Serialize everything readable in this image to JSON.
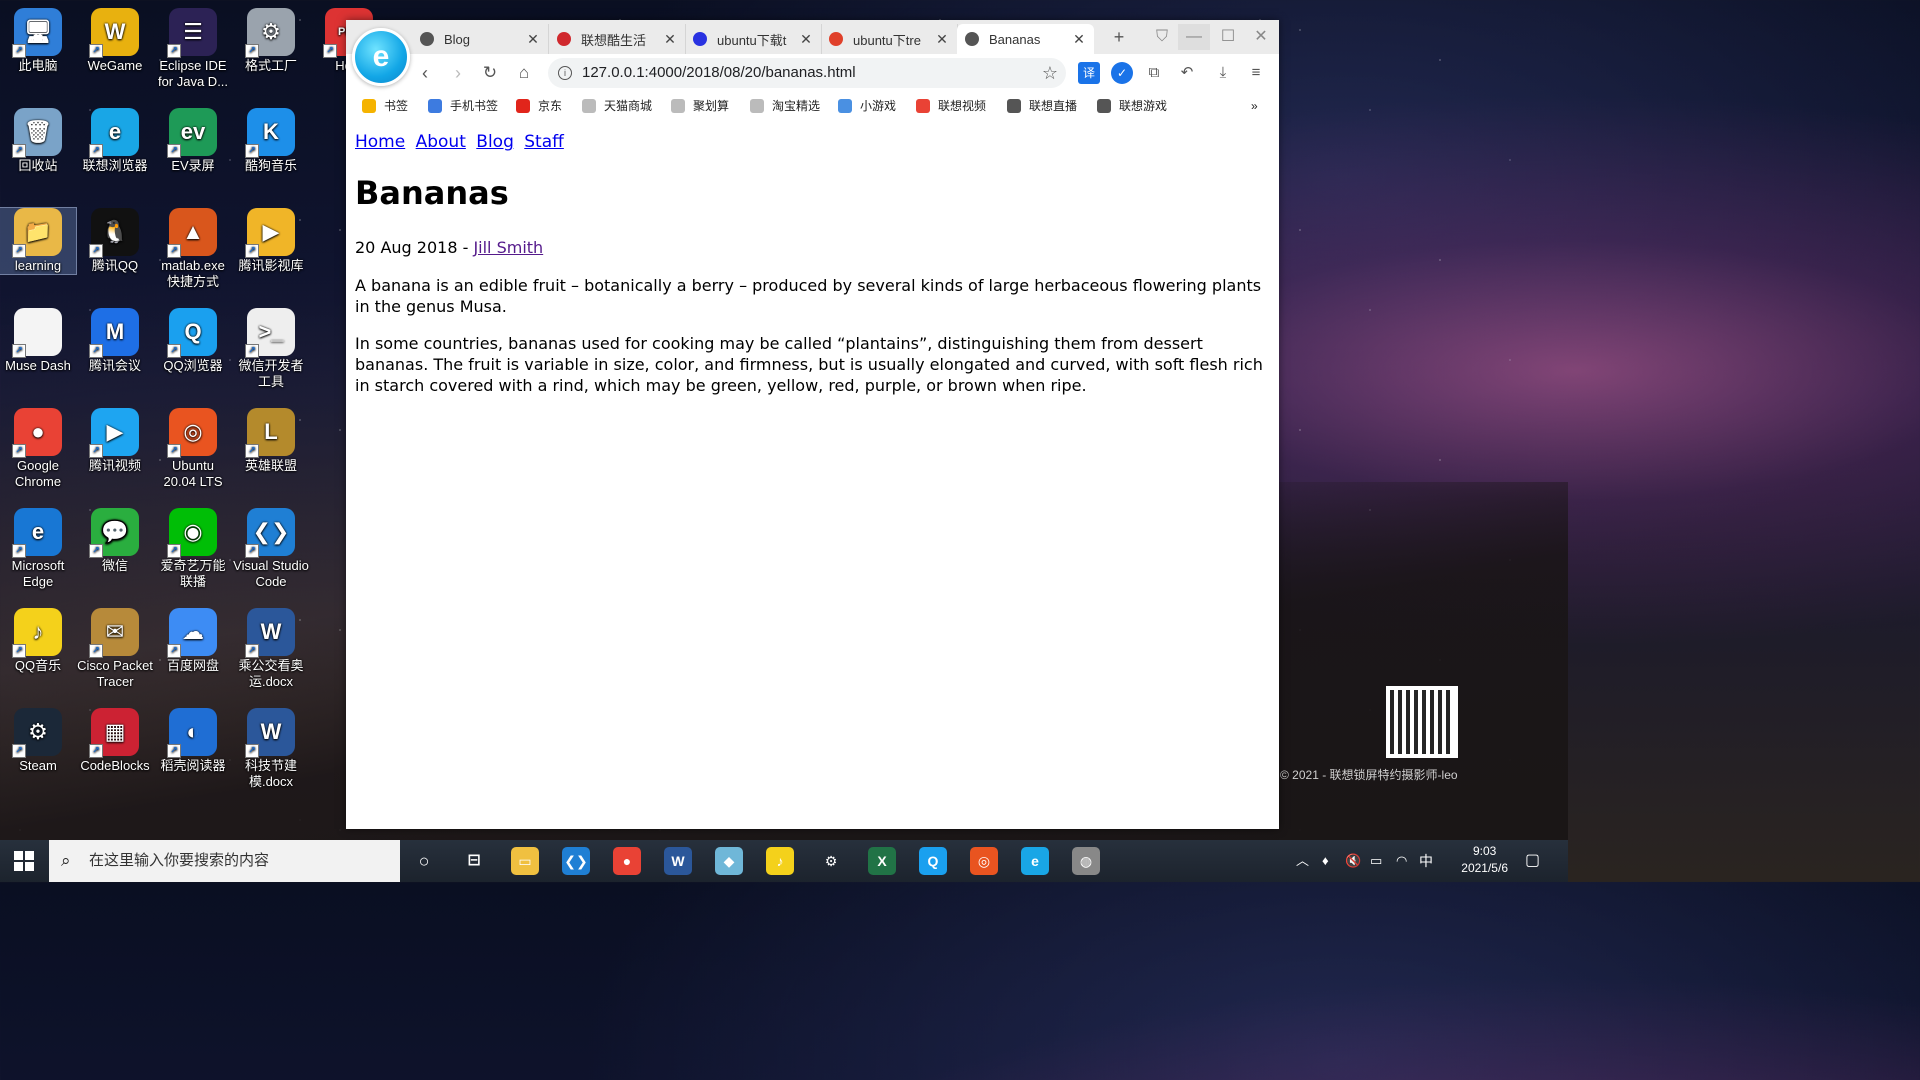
{
  "desktop": {
    "icons": [
      {
        "label": "此电脑",
        "color": "#2f7ed8",
        "glyph": "🖥"
      },
      {
        "label": "WeGame",
        "color": "#e8b10f",
        "glyph": "W"
      },
      {
        "label": "Eclipse IDE for Java D...",
        "color": "#2c2255",
        "glyph": "☰"
      },
      {
        "label": "格式工厂",
        "color": "#9aa3ad",
        "glyph": "⚙"
      },
      {
        "label": "Hom",
        "color": "#d33",
        "glyph": "PDF"
      },
      {
        "label": "回收站",
        "color": "#7aa3c8",
        "glyph": "🗑"
      },
      {
        "label": "联想浏览器",
        "color": "#19a6e6",
        "glyph": "e"
      },
      {
        "label": "EV录屏",
        "color": "#1e9a57",
        "glyph": "ev"
      },
      {
        "label": "酷狗音乐",
        "color": "#1d8fe9",
        "glyph": "K"
      },
      {
        "label": "learning",
        "color": "#e9b847",
        "glyph": "📁"
      },
      {
        "label": "腾讯QQ",
        "color": "#111",
        "glyph": "🐧"
      },
      {
        "label": "matlab.exe 快捷方式",
        "color": "#d9561c",
        "glyph": "▲"
      },
      {
        "label": "腾讯影视库",
        "color": "#f0b528",
        "glyph": "▶"
      },
      {
        "label": "Muse Dash",
        "color": "#f4f4f4",
        "glyph": ""
      },
      {
        "label": "腾讯会议",
        "color": "#1e6fe6",
        "glyph": "M"
      },
      {
        "label": "QQ浏览器",
        "color": "#1aa0ef",
        "glyph": "Q"
      },
      {
        "label": "微信开发者工具",
        "color": "#eee",
        "glyph": ">_"
      },
      {
        "label": "Google Chrome",
        "color": "#e94235",
        "glyph": "●"
      },
      {
        "label": "腾讯视频",
        "color": "#1ea5f1",
        "glyph": "▶"
      },
      {
        "label": "Ubuntu 20.04 LTS",
        "color": "#e95420",
        "glyph": "◎"
      },
      {
        "label": "英雄联盟",
        "color": "#b48a2c",
        "glyph": "L"
      },
      {
        "label": "Microsoft Edge",
        "color": "#1877d4",
        "glyph": "e"
      },
      {
        "label": "微信",
        "color": "#2aae3f",
        "glyph": "💬"
      },
      {
        "label": "爱奇艺万能联播",
        "color": "#00be06",
        "glyph": "◉"
      },
      {
        "label": "Visual Studio Code",
        "color": "#1f7fd4",
        "glyph": "❮❯"
      },
      {
        "label": "QQ音乐",
        "color": "#f4d11b",
        "glyph": "♪"
      },
      {
        "label": "Cisco Packet Tracer",
        "color": "#b78a3a",
        "glyph": "✉"
      },
      {
        "label": "百度网盘",
        "color": "#3d8cf4",
        "glyph": "☁"
      },
      {
        "label": "乘公交看奥运.docx",
        "color": "#2b579a",
        "glyph": "W"
      },
      {
        "label": "Steam",
        "color": "#1b2838",
        "glyph": "⚙"
      },
      {
        "label": "CodeBlocks",
        "color": "#c23",
        "glyph": "▦"
      },
      {
        "label": "稻壳阅读器",
        "color": "#1f6ed4",
        "glyph": "◐"
      },
      {
        "label": "科技节建模.docx",
        "color": "#2b579a",
        "glyph": "W"
      }
    ]
  },
  "browser": {
    "tabs": [
      {
        "title": "Blog",
        "favicon_color": "#555"
      },
      {
        "title": "联想酷生活",
        "favicon_color": "#d0282d"
      },
      {
        "title": "ubuntu下载t",
        "favicon_color": "#2932e1"
      },
      {
        "title": "ubuntu下tre",
        "favicon_color": "#e0402a"
      },
      {
        "title": "Bananas",
        "favicon_color": "#555"
      }
    ],
    "new_tab": "+",
    "url": "127.0.0.1:4000/2018/08/20/bananas.html",
    "bookmarks": [
      {
        "label": "书签",
        "color": "#f5b300"
      },
      {
        "label": "手机书签",
        "color": "#3d7be0"
      },
      {
        "label": "京东",
        "color": "#e1251b"
      },
      {
        "label": "天猫商城",
        "color": "#bbb"
      },
      {
        "label": "聚划算",
        "color": "#bbb"
      },
      {
        "label": "淘宝精选",
        "color": "#bbb"
      },
      {
        "label": "小游戏",
        "color": "#4a90e2"
      },
      {
        "label": "联想视频",
        "color": "#e94235"
      },
      {
        "label": "联想直播",
        "color": "#555"
      },
      {
        "label": "联想游戏",
        "color": "#555"
      }
    ],
    "bookmarks_more": "»",
    "page": {
      "nav": [
        "Home",
        "About",
        "Blog",
        "Staff"
      ],
      "title": "Bananas",
      "date": "20 Aug 2018 - ",
      "author": "Jill Smith",
      "paragraphs": [
        "A banana is an edible fruit – botanically a berry – produced by several kinds of large herbaceous flowering plants in the genus Musa.",
        "In some countries, bananas used for cooking may be called “plantains”, distinguishing them from dessert bananas. The fruit is variable in size, color, and firmness, but is usually elongated and curved, with soft flesh rich in starch covered with a rind, which may be green, yellow, red, purple, or brown when ripe."
      ]
    }
  },
  "taskbar": {
    "search_placeholder": "在这里输入你要搜索的内容",
    "time": "9:03",
    "date": "2021/5/6",
    "ime": "中",
    "apps": [
      {
        "name": "file-explorer",
        "color": "#f0c040",
        "glyph": "▭"
      },
      {
        "name": "vscode",
        "color": "#1f7fd4",
        "glyph": "❮❯"
      },
      {
        "name": "chrome",
        "color": "#e94235",
        "glyph": "●"
      },
      {
        "name": "word",
        "color": "#2b579a",
        "glyph": "W"
      },
      {
        "name": "notes",
        "color": "#6fb7d8",
        "glyph": "◆"
      },
      {
        "name": "app-green",
        "color": "#f4d11b",
        "glyph": "♪"
      },
      {
        "name": "settings",
        "color": "transparent",
        "glyph": "⚙"
      },
      {
        "name": "excel",
        "color": "#217346",
        "glyph": "X"
      },
      {
        "name": "qq-browser",
        "color": "#1aa0ef",
        "glyph": "Q"
      },
      {
        "name": "ubuntu",
        "color": "#e95420",
        "glyph": "◎"
      },
      {
        "name": "lenovo-browser",
        "color": "#19a6e6",
        "glyph": "e"
      },
      {
        "name": "avatar-app",
        "color": "#888",
        "glyph": "◍"
      }
    ]
  },
  "wallpaper": {
    "copyright": "© 2021 - 联想锁屏特约摄影师-leo"
  }
}
